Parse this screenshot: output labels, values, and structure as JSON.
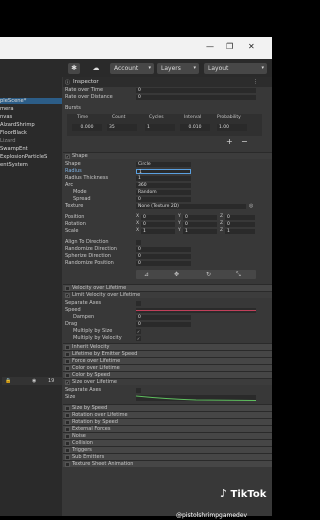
{
  "window": {
    "minimize": "—",
    "restore": "❐",
    "close": "✕"
  },
  "toolbar": {
    "account": "Account",
    "layers": "Layers",
    "layout": "Layout"
  },
  "hierarchy": {
    "items": [
      "pleScene*",
      "mera",
      "nvas",
      "AlzardShrimp",
      "FloorBlack",
      "Lizard",
      "SwampEnt",
      "ExplosionParticleS",
      "entSystem"
    ]
  },
  "bottom_panel": {
    "count": "19"
  },
  "inspector": {
    "title": "Inspector",
    "rate_over_time": {
      "label": "Rate over Time",
      "value": "0"
    },
    "rate_over_distance": {
      "label": "Rate over Distance",
      "value": "0"
    },
    "bursts": {
      "label": "Bursts",
      "headers": [
        "Time",
        "Count",
        "Cycles",
        "Interval",
        "Probability"
      ],
      "values": [
        "0.000",
        "35",
        "1",
        "0.010",
        "1.00"
      ]
    },
    "shape_module": "Shape",
    "shape": {
      "label": "Shape",
      "value": "Circle"
    },
    "radius": {
      "label": "Radius",
      "value": "1"
    },
    "radius_thickness": {
      "label": "Radius Thickness",
      "value": "1"
    },
    "arc": {
      "label": "Arc",
      "value": "360"
    },
    "mode": {
      "label": "Mode",
      "value": "Random"
    },
    "spread": {
      "label": "Spread",
      "value": "0"
    },
    "texture": {
      "label": "Texture",
      "value": "None (Texture 2D)"
    },
    "position": {
      "label": "Position",
      "x": "0",
      "y": "0",
      "z": "0"
    },
    "rotation": {
      "label": "Rotation",
      "x": "0",
      "y": "0",
      "z": "0"
    },
    "scale": {
      "label": "Scale",
      "x": "1",
      "y": "1",
      "z": "1"
    },
    "align": "Align To Direction",
    "rand_dir": {
      "label": "Randomize Direction",
      "value": "0"
    },
    "spher_dir": {
      "label": "Spherize Direction",
      "value": "0"
    },
    "rand_pos": {
      "label": "Randomize Position",
      "value": "0"
    },
    "modules_a": [
      "Velocity over Lifetime",
      "Limit Velocity over Lifetime"
    ],
    "separate_axes": "Separate Axes",
    "speed": "Speed",
    "dampen": {
      "label": "Dampen",
      "value": "0"
    },
    "drag": {
      "label": "Drag",
      "value": "0"
    },
    "multiply_size": "Multiply by Size",
    "multiply_velocity": "Multiply by Velocity",
    "modules_b": [
      "Inherit Velocity",
      "Lifetime by Emitter Speed",
      "Force over Lifetime",
      "Color over Lifetime",
      "Color by Speed",
      "Size over Lifetime"
    ],
    "separate_axes2": "Separate Axes",
    "size": "Size",
    "modules_c": [
      "Size by Speed",
      "Rotation over Lifetime",
      "Rotation by Speed",
      "External Forces",
      "Noise",
      "Collision",
      "Triggers",
      "Sub Emitters",
      "Texture Sheet Animation"
    ]
  },
  "watermark": {
    "brand": "TikTok",
    "handle": "@pistolshrimpgamedev"
  }
}
